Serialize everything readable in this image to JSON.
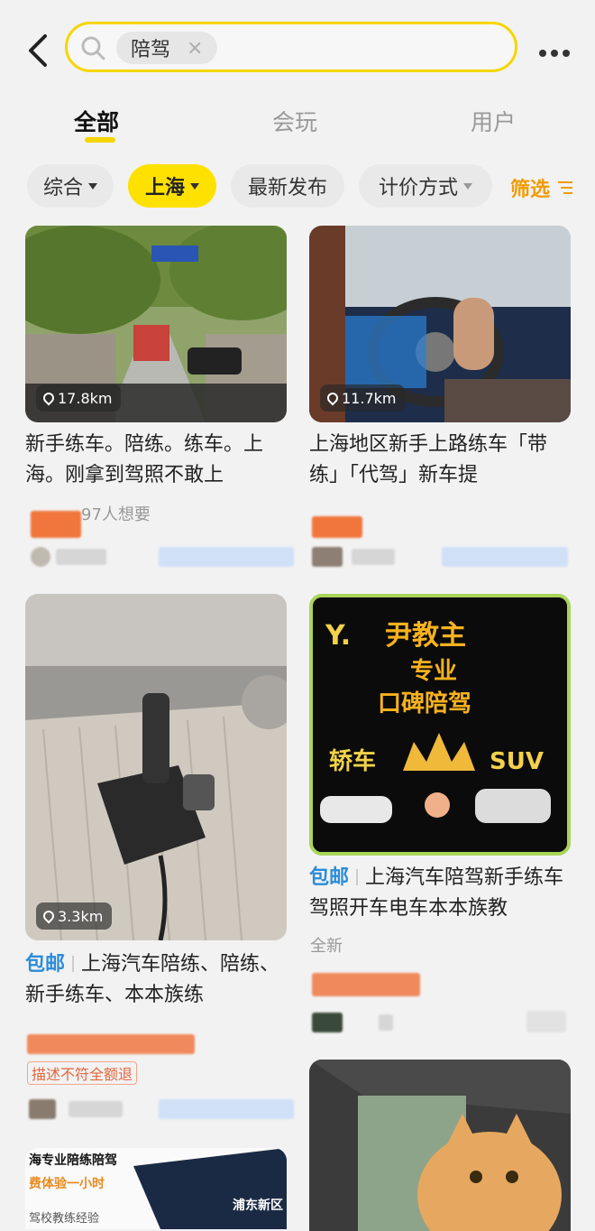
{
  "search": {
    "keyword": "陪驾",
    "clear": "×"
  },
  "tabs": [
    "全部",
    "会玩",
    "用户"
  ],
  "filters": {
    "sort": "综合",
    "city": "上海",
    "latest": "最新发布",
    "pricing": "计价方式",
    "filter": "筛选"
  },
  "cards": [
    {
      "distance": "17.8km",
      "title": "新手练车。陪练。练车。上海。刚拿到驾照不敢上",
      "want": "97人想要"
    },
    {
      "distance": "11.7km",
      "title": "上海地区新手上路练车「带练」「代驾」新车提"
    },
    {
      "distance": "3.3km",
      "badge": "包邮",
      "title": "上海汽车陪练、陪练、新手练车、本本族练",
      "tag": "描述不符全额退"
    },
    {
      "badge": "包邮",
      "title": "上海汽车陪驾新手练车驾照开车电车本本族教",
      "condition": "全新",
      "poster": {
        "brand": "Y.",
        "name": "尹教主",
        "line1": "专业",
        "line2": "口碑陪驾",
        "left": "轿车",
        "right": "SUV"
      }
    },
    {
      "banner1": "海专业陪练陪驾",
      "banner2": "费体验一小时",
      "banner3": "驾校教练经验",
      "banner4": "浦东新区"
    }
  ],
  "colors": {
    "accent": "#f5d600",
    "badge": "#2a8cd8",
    "filter": "#f29b00"
  }
}
